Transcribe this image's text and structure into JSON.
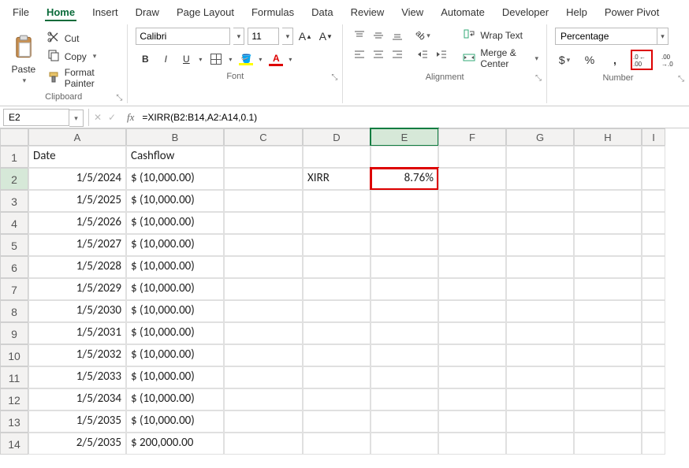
{
  "menu": [
    "File",
    "Home",
    "Insert",
    "Draw",
    "Page Layout",
    "Formulas",
    "Data",
    "Review",
    "View",
    "Automate",
    "Developer",
    "Help",
    "Power Pivot"
  ],
  "menu_active": 1,
  "clipboard": {
    "paste": "Paste",
    "cut": "Cut",
    "copy": "Copy",
    "painter": "Format Painter",
    "group": "Clipboard"
  },
  "font": {
    "name": "Calibri",
    "size": "11",
    "group": "Font"
  },
  "alignment": {
    "wrap": "Wrap Text",
    "merge": "Merge & Center",
    "group": "Alignment"
  },
  "number": {
    "format": "Percentage",
    "group": "Number"
  },
  "namebox": "E2",
  "formula": "=XIRR(B2:B14,A2:A14,0.1)",
  "columns": [
    "A",
    "B",
    "C",
    "D",
    "E",
    "F",
    "G",
    "H",
    "I"
  ],
  "rows": [
    "1",
    "2",
    "3",
    "4",
    "5",
    "6",
    "7",
    "8",
    "9",
    "10",
    "11",
    "12",
    "13",
    "14"
  ],
  "headers": {
    "A": "Date",
    "B": "Cashflow"
  },
  "data": [
    {
      "date": "1/5/2024",
      "cash": "$  (10,000.00)"
    },
    {
      "date": "1/5/2025",
      "cash": "$  (10,000.00)"
    },
    {
      "date": "1/5/2026",
      "cash": "$  (10,000.00)"
    },
    {
      "date": "1/5/2027",
      "cash": "$  (10,000.00)"
    },
    {
      "date": "1/5/2028",
      "cash": "$  (10,000.00)"
    },
    {
      "date": "1/5/2029",
      "cash": "$  (10,000.00)"
    },
    {
      "date": "1/5/2030",
      "cash": "$  (10,000.00)"
    },
    {
      "date": "1/5/2031",
      "cash": "$  (10,000.00)"
    },
    {
      "date": "1/5/2032",
      "cash": "$  (10,000.00)"
    },
    {
      "date": "1/5/2033",
      "cash": "$  (10,000.00)"
    },
    {
      "date": "1/5/2034",
      "cash": "$  (10,000.00)"
    },
    {
      "date": "1/5/2035",
      "cash": "$  (10,000.00)"
    },
    {
      "date": "2/5/2035",
      "cash": "$ 200,000.00"
    }
  ],
  "d2": "XIRR",
  "e2": "8.76%",
  "selected_cell": "E2",
  "highlighted": {
    "e2": true,
    "increase_decimal": true
  }
}
